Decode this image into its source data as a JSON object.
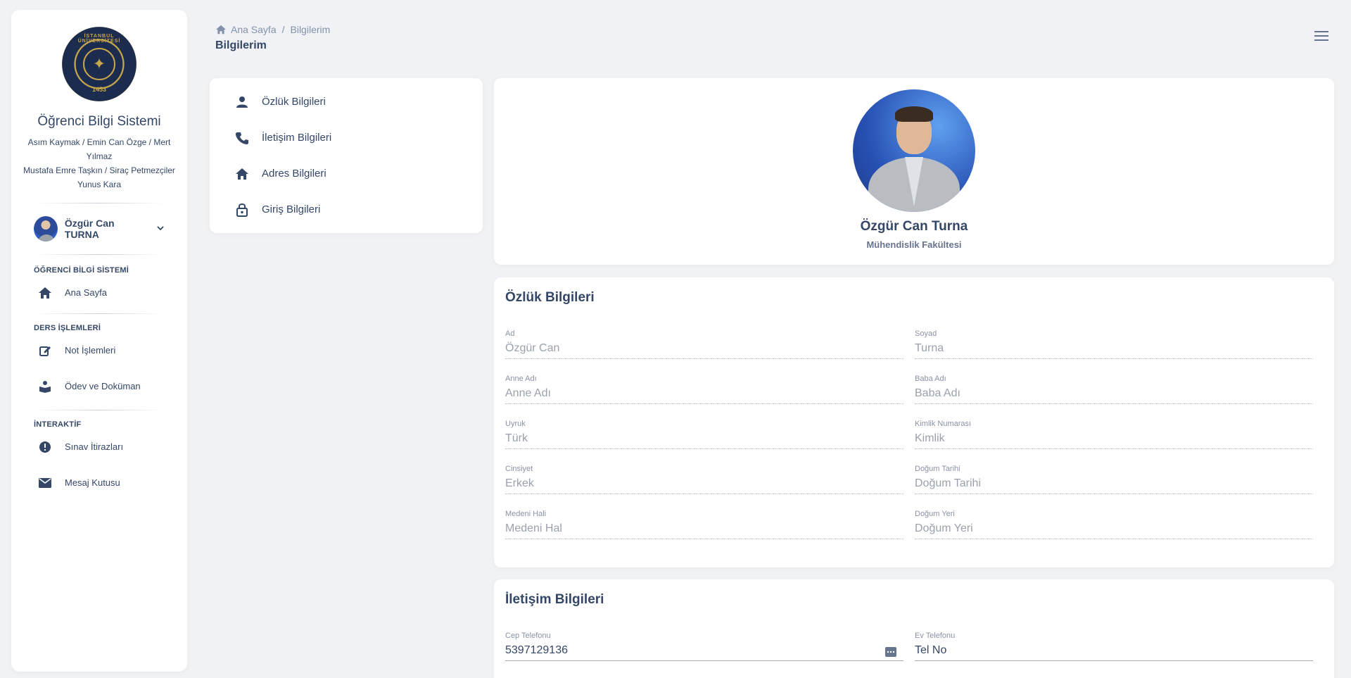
{
  "sidebar": {
    "logo": {
      "top_text": "İSTANBUL ÜNİVERSİTESİ",
      "year": "1453"
    },
    "app_title": "Öğrenci Bilgi Sistemi",
    "authors_line1": "Asım Kaymak / Emin Can Özge / Mert Yılmaz",
    "authors_line2": "Mustafa Emre Taşkın / Siraç Petmezçiler",
    "authors_line3": "Yunus Kara",
    "user_name": "Özgür Can TURNA",
    "sections": [
      {
        "label": "ÖĞRENCİ BİLGİ SİSTEMİ",
        "items": [
          {
            "label": "Ana Sayfa",
            "icon": "home-icon"
          }
        ]
      },
      {
        "label": "DERS İŞLEMLERİ",
        "items": [
          {
            "label": "Not İşlemleri",
            "icon": "edit-icon"
          },
          {
            "label": "Ödev ve Doküman",
            "icon": "book-reader-icon"
          }
        ]
      },
      {
        "label": "İNTERAKTİF",
        "items": [
          {
            "label": "Sınav İtirazları",
            "icon": "exclamation-circle-icon"
          },
          {
            "label": "Mesaj Kutusu",
            "icon": "envelope-icon"
          }
        ]
      }
    ]
  },
  "header": {
    "breadcrumb_home": "Ana Sayfa",
    "breadcrumb_sep": "/",
    "breadcrumb_current": "Bilgilerim",
    "page_title": "Bilgilerim"
  },
  "info_menu": [
    {
      "label": "Özlük Bilgileri",
      "icon": "person-icon"
    },
    {
      "label": "İletişim Bilgileri",
      "icon": "phone-icon"
    },
    {
      "label": "Adres Bilgileri",
      "icon": "home-icon"
    },
    {
      "label": "Giriş Bilgileri",
      "icon": "lock-icon"
    }
  ],
  "profile": {
    "name": "Özgür Can Turna",
    "faculty": "Mühendislik Fakültesi"
  },
  "ozluk": {
    "title": "Özlük Bilgileri",
    "fields": [
      {
        "label": "Ad",
        "value": "Özgür Can"
      },
      {
        "label": "Soyad",
        "value": "Turna"
      },
      {
        "label": "Anne Adı",
        "value": "Anne Adı"
      },
      {
        "label": "Baba Adı",
        "value": "Baba Adı"
      },
      {
        "label": "Uyruk",
        "value": "Türk"
      },
      {
        "label": "Kimlik Numarası",
        "value": "Kimlik"
      },
      {
        "label": "Cinsiyet",
        "value": "Erkek"
      },
      {
        "label": "Doğum Tarihi",
        "value": "Doğum Tarihi"
      },
      {
        "label": "Medeni Hali",
        "value": "Medeni Hal"
      },
      {
        "label": "Doğum Yeri",
        "value": "Doğum Yeri"
      }
    ]
  },
  "iletisim": {
    "title": "İletişim Bilgileri",
    "fields": [
      {
        "label": "Cep Telefonu",
        "value": "5397129136"
      },
      {
        "label": "Ev Telefonu",
        "value": "Tel No"
      }
    ]
  },
  "colors": {
    "background": "#f0f2f5",
    "text_primary": "#344767",
    "text_muted": "#8392ab",
    "logo_navy": "#1b2c4f",
    "logo_gold": "#c8a64b"
  }
}
